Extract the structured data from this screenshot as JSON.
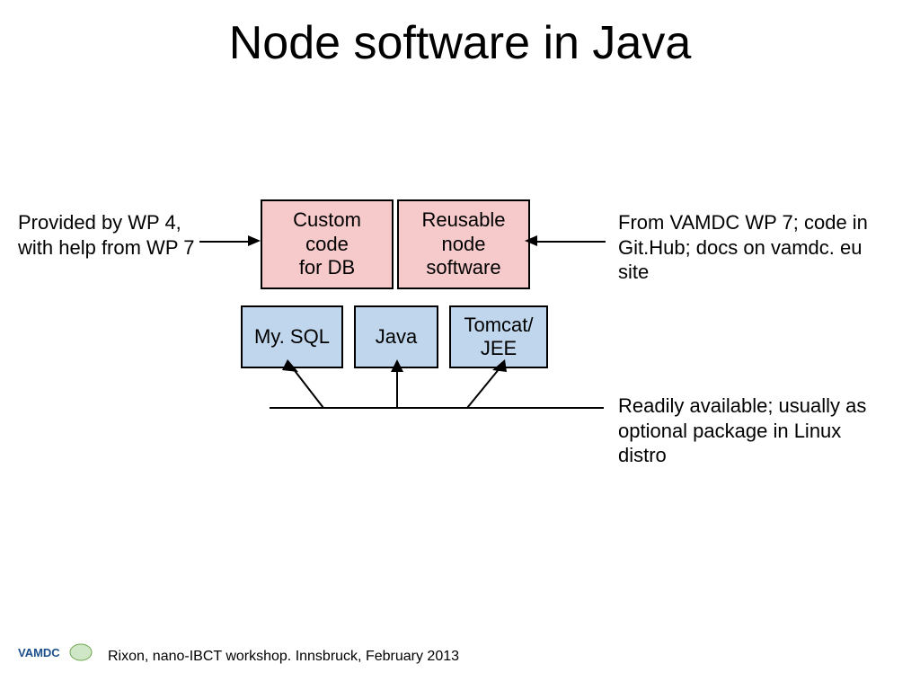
{
  "title": "Node software in Java",
  "left_label": "Provided by WP 4, with help from WP 7",
  "right_label": "From VAMDC WP 7; code in Git.Hub; docs on vamdc. eu site",
  "readily_label": "Readily available; usually as optional package in Linux distro",
  "boxes": {
    "custom_code": "Custom\ncode\nfor DB",
    "reusable_node": "Reusable\nnode\nsoftware",
    "mysql": "My. SQL",
    "java": "Java",
    "tomcat": "Tomcat/\nJEE"
  },
  "footer": "Rixon, nano-IBCT workshop. Innsbruck, February 2013",
  "logo_text": "VAMDC"
}
